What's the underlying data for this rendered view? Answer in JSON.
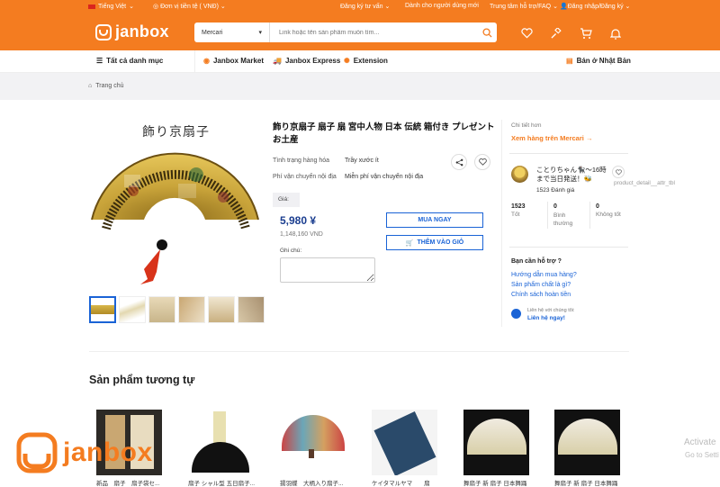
{
  "colors": {
    "brand": "#f47c20",
    "link": "#1a63d6",
    "price": "#1a3d8f",
    "bg_grey": "#f2f2f4"
  },
  "topbar": {
    "language": "Tiếng Việt",
    "currency": "Đơn vị tiền tệ ( VNĐ)",
    "consult": "Đăng ký tư vấn",
    "newcomer": "Dành cho người dùng mới",
    "help": "Trung tâm hỗ trợ/FAQ",
    "login": "Đăng nhập/Đăng ký"
  },
  "logo": {
    "text": "janbox"
  },
  "search": {
    "category": "Mercari",
    "placeholder": "Link hoặc tên sản phẩm muốn tìm..."
  },
  "nav": {
    "all_categories": "Tất cả danh mục",
    "market": "Janbox Market",
    "express": "Janbox Express",
    "extension": "Extension",
    "sell_japan": "Bán ở Nhật Bản"
  },
  "breadcrumb": {
    "home": "Trang chủ"
  },
  "product": {
    "image_caption": "飾り京扇子",
    "title": "飾り京扇子 扇子 扇 宮中人物 日本 伝統 箱付き プレゼント お土産",
    "condition_label": "Tình trạng hàng hóa",
    "condition_value": "Trầy xước ít",
    "shipping_label": "Phí vận chuyển nội địa",
    "shipping_value": "Miễn phí vận chuyển nội địa",
    "price_label": "Giá:",
    "price_yen": "5,980 ¥",
    "price_vnd": "1,148,160 VND",
    "note_label": "Ghi chú:",
    "buy_now": "MUA NGAY",
    "add_to_cart": "THÊM VÀO GIỎ"
  },
  "seller": {
    "source_label": "Chi tiết hơn",
    "source_link": "Xem hàng trên Mercari",
    "name": "ことりちゃん🐈‍⬛〜16時まで当日発送！🐝",
    "reviews": "1523 Đánh giá",
    "alt_text": "product_detail__attr_tbl",
    "stats": [
      {
        "value": "1523",
        "label": "Tốt"
      },
      {
        "value": "0",
        "label": "Bình thường"
      },
      {
        "value": "0",
        "label": "Không tốt"
      }
    ]
  },
  "support": {
    "title": "Bạn cần hỗ trợ ?",
    "links": [
      "Hướng dẫn mua hàng?",
      "Sản phẩm chất là gì?",
      "Chính sách hoàn tiền"
    ],
    "contact_small": "Liên hệ với chúng tôi:",
    "contact_link": "Liên hệ ngay!"
  },
  "similar": {
    "title": "Sản phẩm tương tự",
    "items": [
      "新品　扇子　扇子袋セ...",
      "扇子 シャル型 五日扇子...",
      "揚羽蝶　大柄入り扇子...",
      "ケイタマルヤマ　　扇",
      "舞扇子 新 扇子 日本舞踊",
      "舞扇子 新 扇子 日本舞踊"
    ]
  },
  "watermark": {
    "text": "janbox"
  },
  "os_notice": {
    "line1": "Activate",
    "line2": "Go to Setti"
  }
}
